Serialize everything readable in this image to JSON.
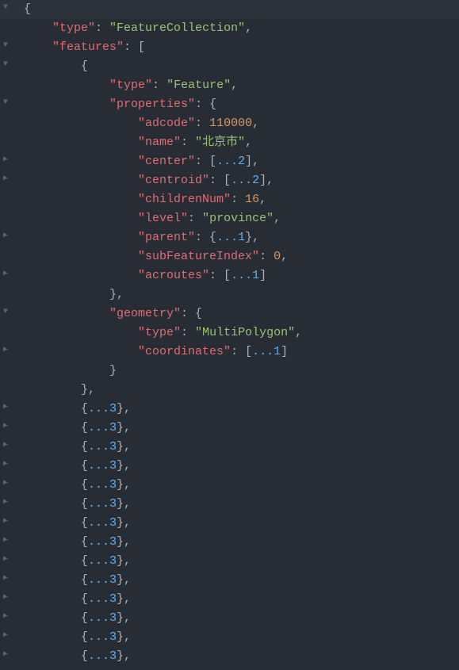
{
  "root_open": "{",
  "root_close": "}",
  "indent": "    ",
  "keys": {
    "type": "\"type\"",
    "features": "\"features\"",
    "properties": "\"properties\"",
    "adcode": "\"adcode\"",
    "name": "\"name\"",
    "center": "\"center\"",
    "centroid": "\"centroid\"",
    "childrenNum": "\"childrenNum\"",
    "level": "\"level\"",
    "parent": "\"parent\"",
    "subFeatureIndex": "\"subFeatureIndex\"",
    "acroutes": "\"acroutes\"",
    "geometry": "\"geometry\"",
    "coordinates": "\"coordinates\""
  },
  "vals": {
    "FeatureCollection": "\"FeatureCollection\"",
    "Feature": "\"Feature\"",
    "adcode": "110000",
    "name": "\"北京市\"",
    "childrenNum": "16",
    "level": "\"province\"",
    "subFeatureIndex": "0",
    "MultiPolygon": "\"MultiPolygon\""
  },
  "fold": {
    "arr2": "...2",
    "obj1": "...1",
    "arr1": "...1",
    "obj3": "...3"
  }
}
